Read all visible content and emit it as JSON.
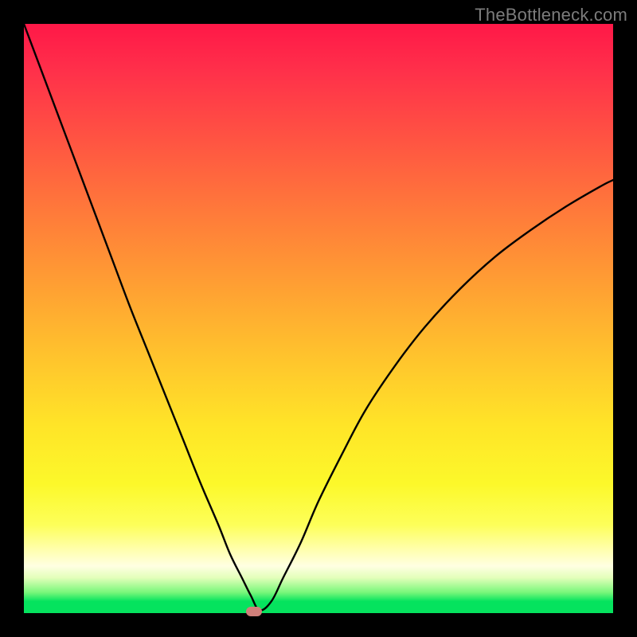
{
  "watermark": "TheBottleneck.com",
  "colors": {
    "frame": "#000000",
    "curve": "#000000",
    "marker": "#d07f7a",
    "gradient_top": "#ff1848",
    "gradient_bottom": "#05e35e"
  },
  "chart_data": {
    "type": "line",
    "title": "",
    "xlabel": "",
    "ylabel": "",
    "xlim": [
      0,
      100
    ],
    "ylim": [
      0,
      100
    ],
    "x": [
      0,
      3,
      6,
      9,
      12,
      15,
      18,
      21,
      24,
      27,
      30,
      33,
      35,
      37,
      38.5,
      40,
      42,
      44,
      47,
      50,
      54,
      58,
      63,
      68,
      74,
      80,
      86,
      92,
      98,
      100
    ],
    "values": [
      100,
      92,
      84,
      76,
      68,
      60,
      52,
      44.5,
      37,
      29.5,
      22,
      15,
      10,
      6,
      3,
      0.5,
      2,
      6,
      12,
      19,
      27,
      34.5,
      42,
      48.5,
      55,
      60.5,
      65,
      69,
      72.5,
      73.5
    ],
    "annotations": [
      {
        "type": "marker",
        "x": 39,
        "y": 0.3,
        "label": "min-point"
      }
    ],
    "grid": false,
    "legend": false
  }
}
